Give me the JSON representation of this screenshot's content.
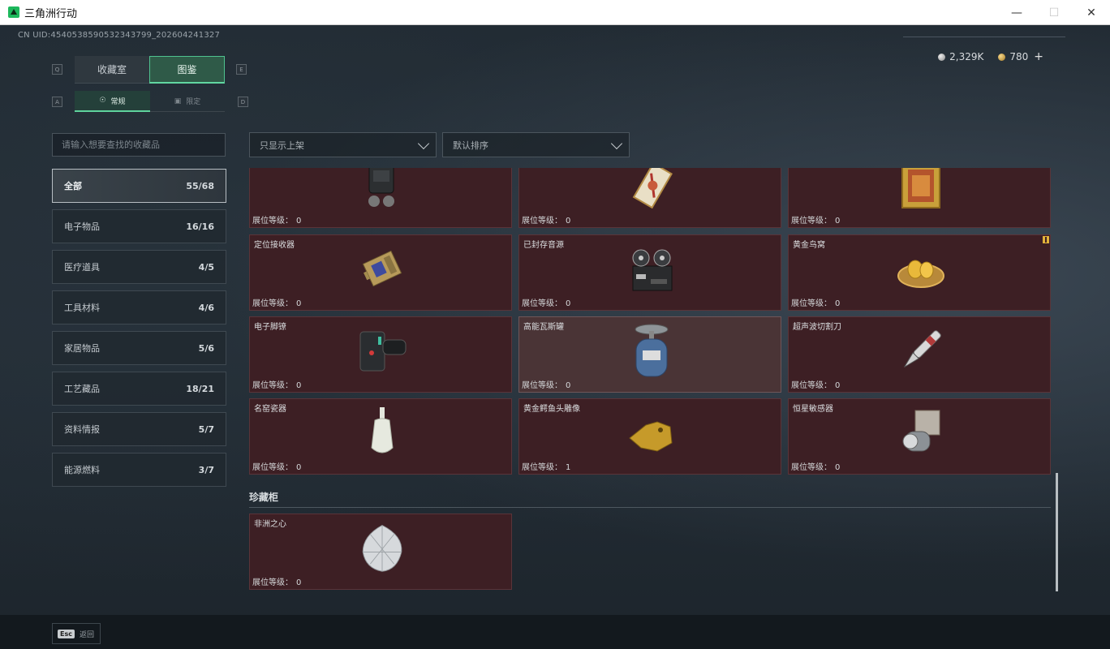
{
  "window": {
    "title": "三角洲行动",
    "minimize": "—",
    "maximize": "☐",
    "close": "✕"
  },
  "header": {
    "uid": "CN UID:4540538590532343799_202604241327",
    "currency": [
      {
        "icon": "silver-coin-icon",
        "value": "2,329K"
      },
      {
        "icon": "gold-coin-icon",
        "value": "780"
      }
    ],
    "add_label": "+"
  },
  "keys": {
    "q": "Q",
    "e": "E",
    "a": "A",
    "d": "D"
  },
  "tabs": {
    "collection": "收藏室",
    "atlas": "图鉴",
    "active": "图鉴"
  },
  "subtabs": {
    "normal": "常规",
    "limited": "限定",
    "active": "常规"
  },
  "search": {
    "placeholder": "请输入想要查找的收藏品"
  },
  "filters": {
    "shelf_filter": "只显示上架",
    "sort": "默认排序"
  },
  "categories": [
    {
      "label": "全部",
      "count": "55/68",
      "active": true
    },
    {
      "label": "电子物品",
      "count": "16/16"
    },
    {
      "label": "医疗道具",
      "count": "4/5"
    },
    {
      "label": "工具材料",
      "count": "4/6"
    },
    {
      "label": "家居物品",
      "count": "5/6"
    },
    {
      "label": "工艺藏品",
      "count": "18/21"
    },
    {
      "label": "资料情报",
      "count": "5/7"
    },
    {
      "label": "能源燃料",
      "count": "3/7"
    }
  ],
  "level_label": "展位等级：",
  "items_partial_row": [
    {
      "name": "",
      "level": "0",
      "icon": "backpack-device-icon"
    },
    {
      "name": "",
      "level": "0",
      "icon": "ornate-card-icon"
    },
    {
      "name": "",
      "level": "0",
      "icon": "framed-painting-icon"
    }
  ],
  "items": [
    {
      "name": "定位接收器",
      "level": "0",
      "icon": "gps-receiver-icon"
    },
    {
      "name": "已封存音源",
      "level": "0",
      "icon": "reel-recorder-icon"
    },
    {
      "name": "黄金鸟窝",
      "level": "0",
      "icon": "golden-nest-icon",
      "marker": true
    },
    {
      "name": "电子脚镣",
      "level": "0",
      "icon": "ankle-monitor-icon"
    },
    {
      "name": "高能瓦斯罐",
      "level": "0",
      "icon": "gas-canister-icon",
      "hover": true
    },
    {
      "name": "超声波切割刀",
      "level": "0",
      "icon": "ultrasonic-cutter-icon"
    },
    {
      "name": "名窑瓷器",
      "level": "0",
      "icon": "porcelain-vase-icon"
    },
    {
      "name": "黄金鳄鱼头雕像",
      "level": "1",
      "icon": "gold-crocodile-icon"
    },
    {
      "name": "恒星敏感器",
      "level": "0",
      "icon": "star-sensor-icon"
    }
  ],
  "treasure_section": {
    "title": "珍藏柜",
    "items": [
      {
        "name": "非洲之心",
        "level": "0",
        "icon": "diamond-icon"
      }
    ]
  },
  "footer": {
    "esc_key": "Esc",
    "back_label": "返回"
  }
}
